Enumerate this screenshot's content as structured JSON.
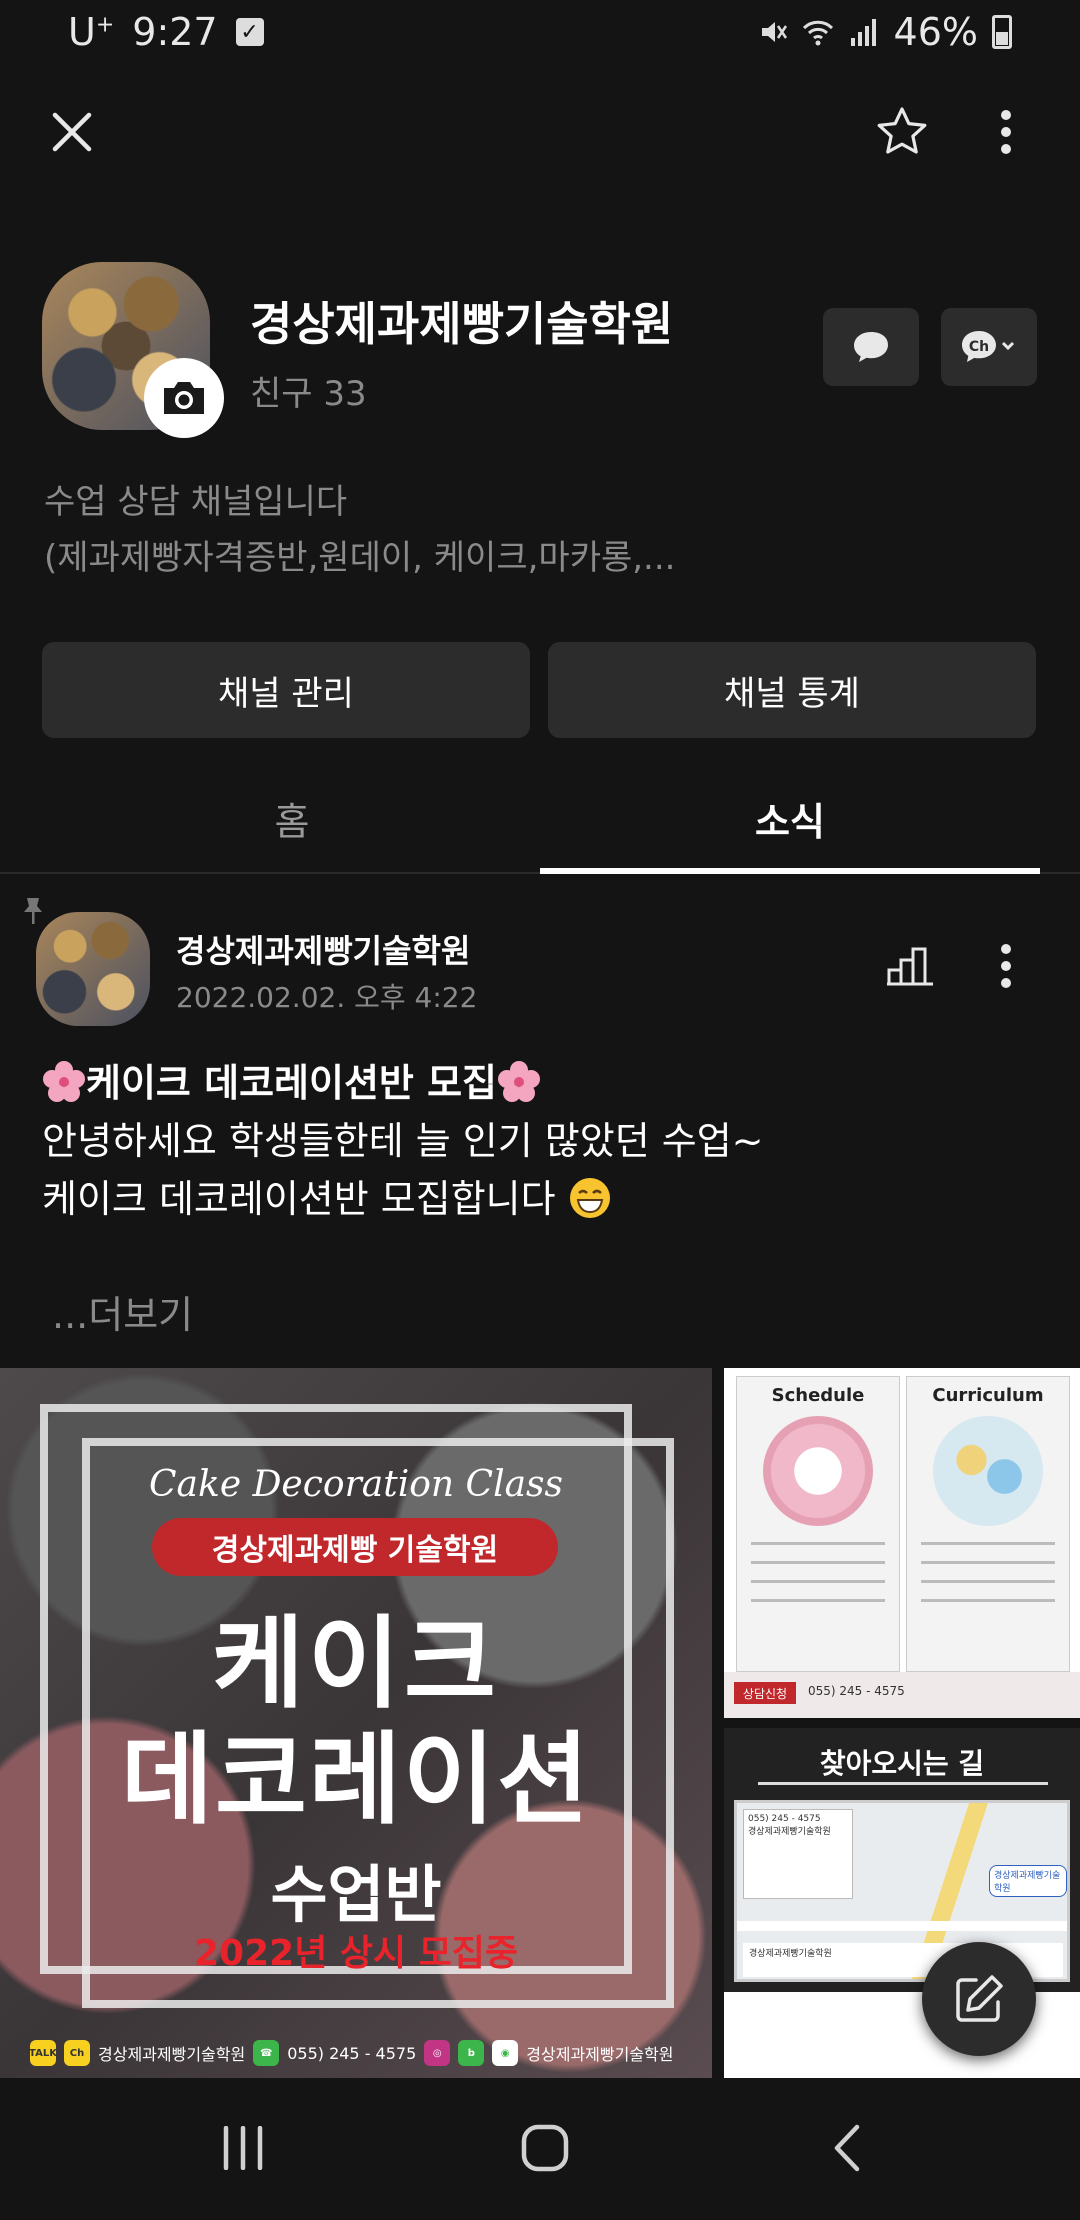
{
  "status_bar": {
    "carrier": "U",
    "carrier_sup": "+",
    "time": "9:27",
    "battery": "46%"
  },
  "channel": {
    "name": "경상제과제빵기술학원",
    "friends": "친구 33",
    "description_line1": "수업 상담 채널입니다",
    "description_line2": "(제과제빵자격증반,원데이, 케이크,마카롱,..."
  },
  "buttons": {
    "manage": "채널 관리",
    "stats": "채널 통계"
  },
  "tabs": {
    "home": "홈",
    "news": "소식"
  },
  "post": {
    "author": "경상제과제빵기술학원",
    "date": "2022.02.02. 오후 4:22",
    "title": "케이크 데코레이션반 모집",
    "line2": "안녕하세요 학생들한테 늘 인기 많았던 수업~",
    "line3": "케이크 데코레이션반 모집합니다",
    "more": "...더보기"
  },
  "poster": {
    "class_title": "Cake Decoration Class",
    "academy": "경상제과제빵 기술학원",
    "big_line1": "케이크",
    "big_line2": "데코레이션",
    "class_label": "수업반",
    "recruit": "2022년 상시 모집중",
    "contact_name": "경상제과제빵기술학원",
    "contact_phone": "055) 245 - 4575",
    "contact_name2": "경상제과제빵기술학원"
  },
  "schedule_card": {
    "schedule_head": "Schedule",
    "curriculum_head": "Curriculum",
    "cta": "상담신청",
    "phone": "055) 245 - 4575"
  },
  "directions_card": {
    "title": "찾아오시는 길",
    "contact": "055) 245 - 4575",
    "academy": "경상제과제빵기술학원"
  },
  "colors": {
    "background": "#141414",
    "button_bg": "#2c2c2c",
    "muted_text": "#8a8a8a",
    "accent_red": "#c0282c"
  }
}
